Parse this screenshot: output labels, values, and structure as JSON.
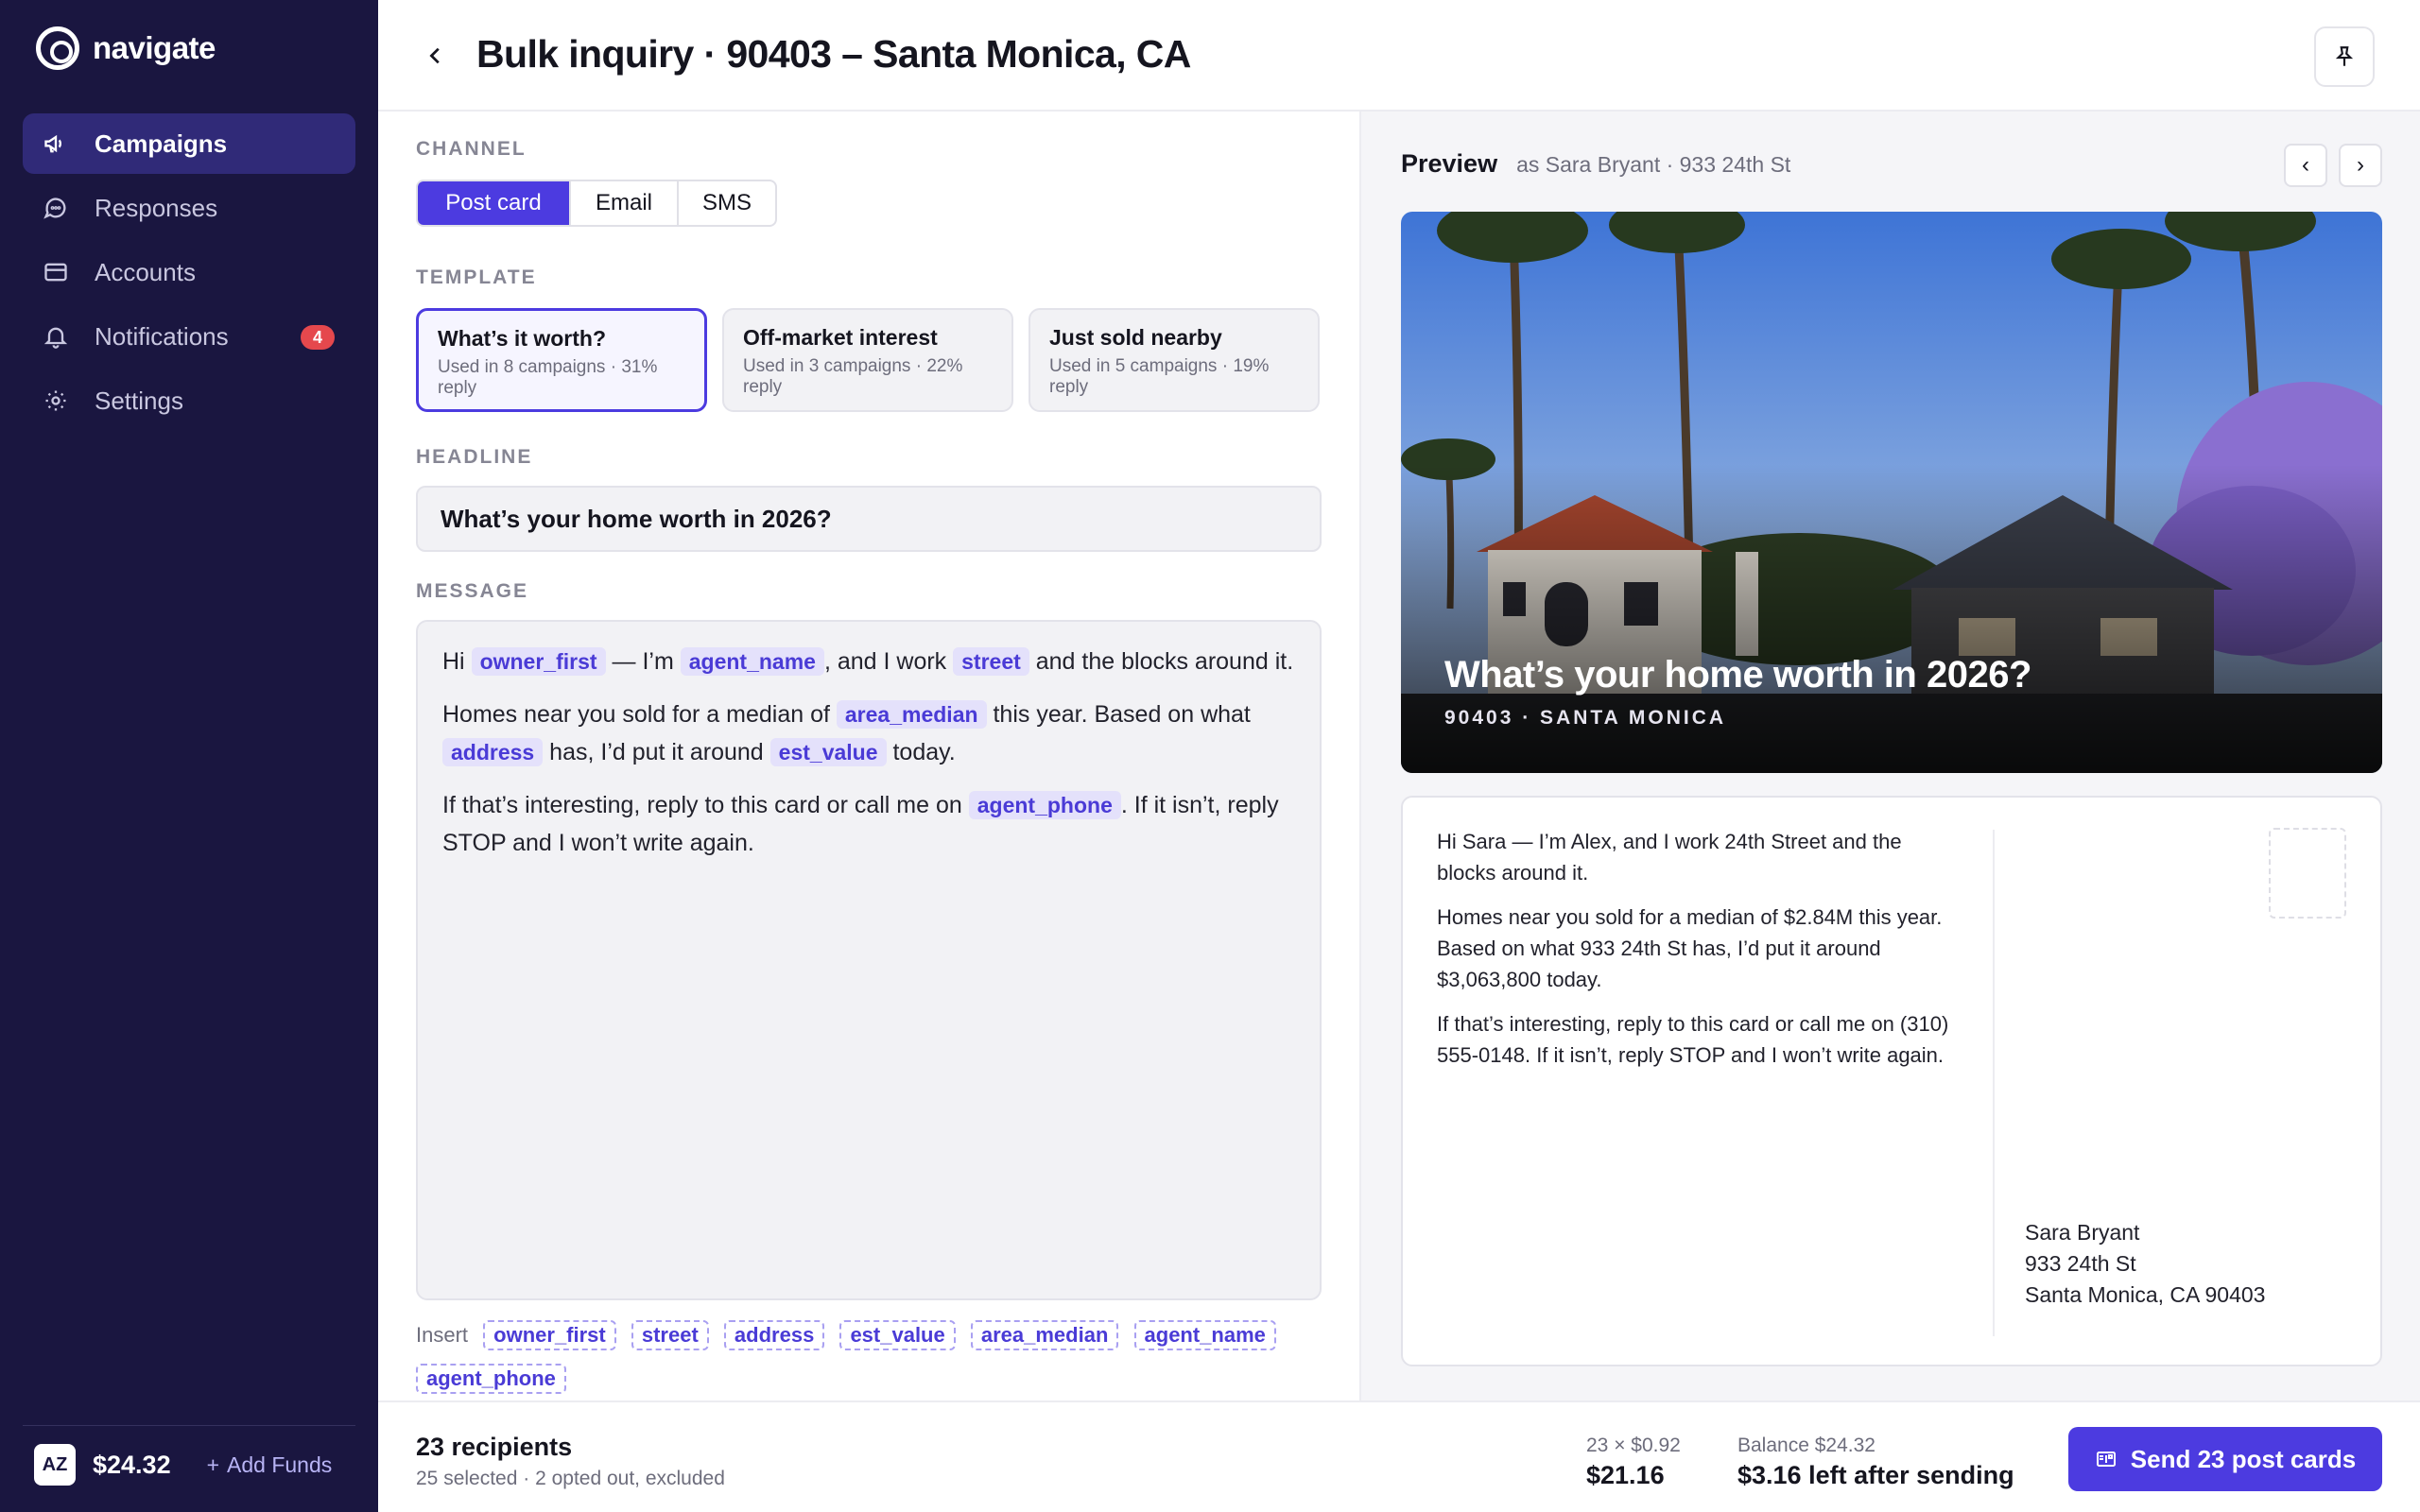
{
  "app": {
    "name": "navigate"
  },
  "sidebar": {
    "items": [
      {
        "label": "Campaigns",
        "icon": "megaphone-icon",
        "active": true
      },
      {
        "label": "Responses",
        "icon": "chat-bubble-icon"
      },
      {
        "label": "Accounts",
        "icon": "credit-card-icon"
      },
      {
        "label": "Notifications",
        "icon": "bell-icon",
        "badge": "4"
      },
      {
        "label": "Settings",
        "icon": "gear-icon"
      }
    ],
    "footer": {
      "avatar": "AZ",
      "balance": "$24.32",
      "add_funds": "Add Funds"
    }
  },
  "header": {
    "title": "Bulk inquiry · 90403 – Santa Monica, CA"
  },
  "editor": {
    "channel_label": "CHANNEL",
    "channels": [
      "Post card",
      "Email",
      "SMS"
    ],
    "selected_channel": "Post card",
    "template_label": "TEMPLATE",
    "templates": [
      {
        "title": "What’s it worth?",
        "meta": "Used in 8 campaigns · 31% reply"
      },
      {
        "title": "Off-market interest",
        "meta": "Used in 3 campaigns · 22% reply"
      },
      {
        "title": "Just sold nearby",
        "meta": "Used in 5 campaigns · 19% reply"
      }
    ],
    "headline_label": "HEADLINE",
    "headline_value": "What’s your home worth in 2026?",
    "message_label": "MESSAGE",
    "message": {
      "p1": {
        "t1": "Hi",
        "tok1": "owner_first",
        "t2": "— I’m",
        "tok2": "agent_name",
        "t3": ", and I work",
        "tok3": "street",
        "t4": "and the blocks around it."
      },
      "p2": {
        "t1": "Homes near you sold for a median of",
        "tok1": "area_median",
        "t2": "this year. Based on what",
        "tok2": "address",
        "t3": "has, I’d put it around",
        "tok3": "est_value",
        "t4": "today."
      },
      "p3": {
        "t1": "If that’s interesting, reply to this card or call me on",
        "tok1": "agent_phone",
        "t2": ". If it isn’t, reply STOP and I won’t write again."
      }
    },
    "insert_label": "Insert",
    "insert_tokens": [
      "owner_first",
      "street",
      "address",
      "est_value",
      "area_median",
      "agent_name",
      "agent_phone"
    ]
  },
  "preview": {
    "title": "Preview",
    "subtitle": "as Sara Bryant · 933 24th St",
    "prev": "‹",
    "next": "›",
    "card_headline": "What’s your home worth in 2026?",
    "card_location": "90403 · SANTA MONICA",
    "back": {
      "p1": "Hi Sara — I’m Alex, and I work 24th Street and the blocks around it.",
      "p2": "Homes near you sold for a median of $2.84M this year. Based on what 933 24th St has, I’d put it around $3,063,800 today.",
      "p3": "If that’s interesting, reply to this card or call me on (310) 555-0148. If it isn’t, reply STOP and I won’t write again."
    },
    "address": {
      "line1": "Sara Bryant",
      "line2": "933 24th St",
      "line3": "Santa Monica, CA 90403"
    }
  },
  "footer": {
    "recipients": "23 recipients",
    "recipients_sub": "25 selected · 2 opted out, excluded",
    "cost_formula": "23 × $0.92",
    "cost_total": "$21.16",
    "balance_label": "Balance $24.32",
    "balance_after": "$3.16 left after sending",
    "send_label": "Send 23 post cards"
  },
  "colors": {
    "accent": "#4c3be0",
    "sidebar": "#1a1640",
    "badge": "#e5484d"
  }
}
